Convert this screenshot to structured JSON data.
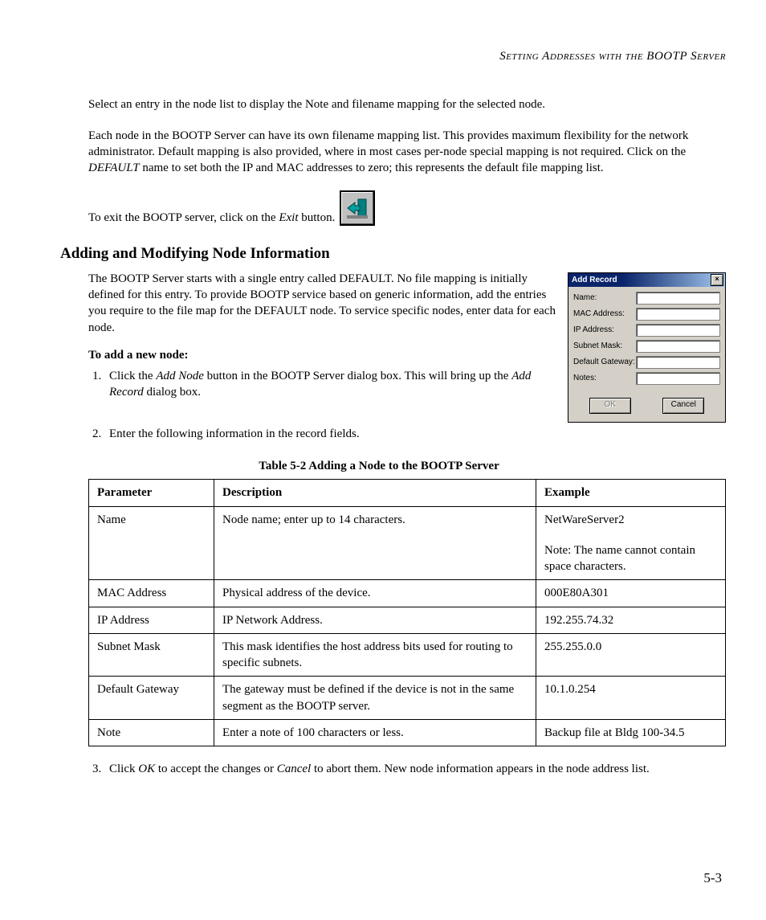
{
  "running_head": "Setting Addresses with the BOOTP Server",
  "p1": "Select an entry in the node list to display the Note and filename mapping for the selected node.",
  "p2_a": "Each node in the BOOTP Server can have its own filename mapping list. This provides maximum flexibility for the network administrator. Default mapping is also provided, where in most cases per-node special mapping is not required. Click on the ",
  "p2_i": "DEFAULT",
  "p2_b": " name to set both the IP and MAC addresses to zero; this represents the default file mapping list.",
  "p3_a": "To exit the BOOTP server, click on the ",
  "p3_i": "Exit",
  "p3_b": " button.",
  "h_adding": "Adding and Modifying Node Information",
  "p4": "The BOOTP Server starts with a single entry called DEFAULT. No file mapping is initially defined for this entry. To provide BOOTP service based on generic information, add the entries you require to the file map for the DEFAULT node. To service specific nodes, enter data for each node.",
  "to_add": "To add a new node:",
  "step1_a": "Click the ",
  "step1_i1": "Add Node",
  "step1_b": " button in the BOOTP Server dialog box. This will bring up the ",
  "step1_i2": "Add Record",
  "step1_c": " dialog box.",
  "step2": "Enter the following information in the record fields.",
  "step3_a": "Click ",
  "step3_i1": "OK",
  "step3_b": " to accept the changes or ",
  "step3_i2": "Cancel",
  "step3_c": " to abort them. New node information appears in the node address list.",
  "dialog": {
    "title": "Add Record",
    "labels": {
      "name": "Name:",
      "mac": "MAC Address:",
      "ip": "IP Address:",
      "subnet": "Subnet Mask:",
      "gateway": "Default Gateway:",
      "notes": "Notes:"
    },
    "ok": "OK",
    "cancel": "Cancel",
    "close": "×"
  },
  "table": {
    "caption": "Table 5-2  Adding a Node to the BOOTP Server",
    "headers": {
      "param": "Parameter",
      "desc": "Description",
      "example": "Example"
    },
    "rows": [
      {
        "param": "Name",
        "desc": "Node name; enter up to 14 characters.",
        "example": "NetWareServer2",
        "example_note": "Note: The name cannot contain space characters."
      },
      {
        "param": "MAC Address",
        "desc": "Physical address of the device.",
        "example": "000E80A301"
      },
      {
        "param": "IP Address",
        "desc": "IP Network Address.",
        "example": "192.255.74.32"
      },
      {
        "param": "Subnet Mask",
        "desc": "This mask identifies the host address bits used for routing to specific subnets.",
        "example": "255.255.0.0"
      },
      {
        "param": "Default Gateway",
        "desc": "The gateway must be defined if the device is not in the same segment as the BOOTP server.",
        "example": "10.1.0.254"
      },
      {
        "param": "Note",
        "desc": "Enter a note of 100 characters or less.",
        "example": "Backup file at Bldg 100-34.5"
      }
    ]
  },
  "page_number": "5-3"
}
